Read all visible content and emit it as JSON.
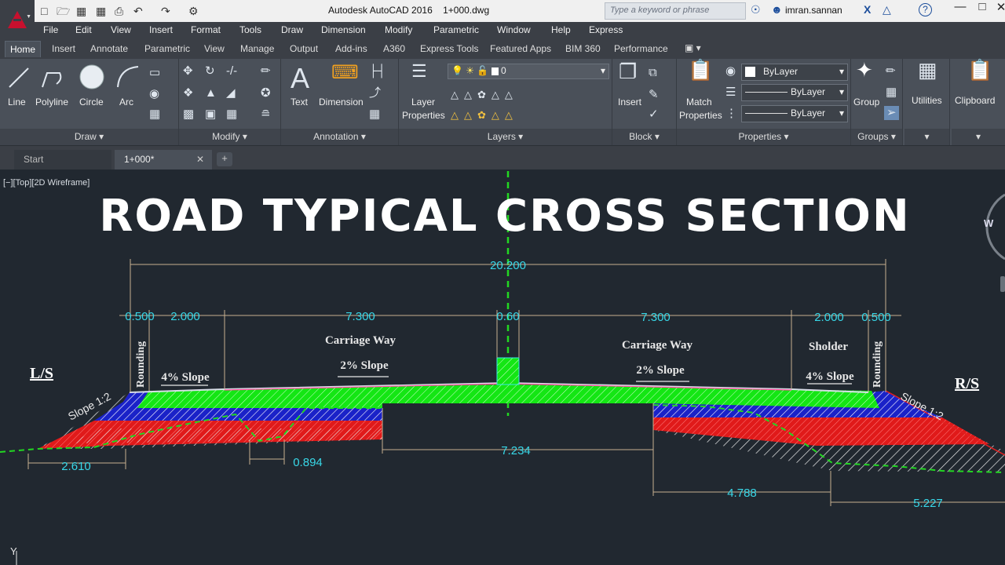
{
  "titlebar": {
    "title": "Autodesk AutoCAD 2016    1+000.dwg",
    "search_placeholder": "Type a keyword or phrase",
    "username": "imran.sannan",
    "help_icon": "?"
  },
  "menu": [
    "File",
    "Edit",
    "View",
    "Insert",
    "Format",
    "Tools",
    "Draw",
    "Dimension",
    "Modify",
    "Parametric",
    "Window",
    "Help",
    "Express"
  ],
  "ribbon_tabs": [
    "Home",
    "Insert",
    "Annotate",
    "Parametric",
    "View",
    "Manage",
    "Output",
    "Add-ins",
    "A360",
    "Express Tools",
    "Featured Apps",
    "BIM 360",
    "Performance"
  ],
  "ribbon": {
    "draw": {
      "title": "Draw",
      "line": "Line",
      "polyline": "Polyline",
      "circle": "Circle",
      "arc": "Arc"
    },
    "modify": {
      "title": "Modify"
    },
    "annotation": {
      "title": "Annotation",
      "text": "Text",
      "dimension": "Dimension"
    },
    "layers": {
      "title": "Layers",
      "layer_properties_1": "Layer",
      "layer_properties_2": "Properties",
      "current_layer": "0"
    },
    "block": {
      "title": "Block",
      "insert": "Insert"
    },
    "properties": {
      "title": "Properties",
      "match_1": "Match",
      "match_2": "Properties",
      "color": "ByLayer",
      "linetype": "ByLayer",
      "lineweight": "ByLayer"
    },
    "groups": {
      "title": "Groups",
      "group": "Group"
    },
    "utilities": "Utilities",
    "clipboard": "Clipboard"
  },
  "doc_tabs": {
    "start": "Start",
    "active": "1+000*"
  },
  "viewport_label": "[−][Top][2D Wireframe]",
  "viewcube_label": "W",
  "ucs_label": "Y",
  "drawing": {
    "heading": "ROAD TYPICAL CROSS SECTION",
    "left_side": "L/S",
    "right_side": "R/S",
    "carriage_way_left": "Carriage Way",
    "carriage_way_right": "Carriage Way",
    "sholder": "Sholder",
    "rounding_left": "Rounding",
    "rounding_right": "Rounding",
    "slope_4_left": "4% Slope",
    "slope_4_right": "4% Slope",
    "slope_2_left": "2% Slope",
    "slope_2_right": "2% Slope",
    "side_slope_left": "Slope 1:2",
    "side_slope_right": "Slope 1:2",
    "dimensions": {
      "total": "20.200",
      "round_left": "0.500",
      "shoulder_left": "2.000",
      "cw_left": "7.300",
      "median": "0.60",
      "cw_right": "7.300",
      "shoulder_right": "2.000",
      "round_right": "0.500",
      "bottom_left": "2.610",
      "bottom_inner": "0.894",
      "bottom_center": "7.234",
      "bottom_right_1": "4.788",
      "bottom_right_2": "5.227"
    }
  }
}
